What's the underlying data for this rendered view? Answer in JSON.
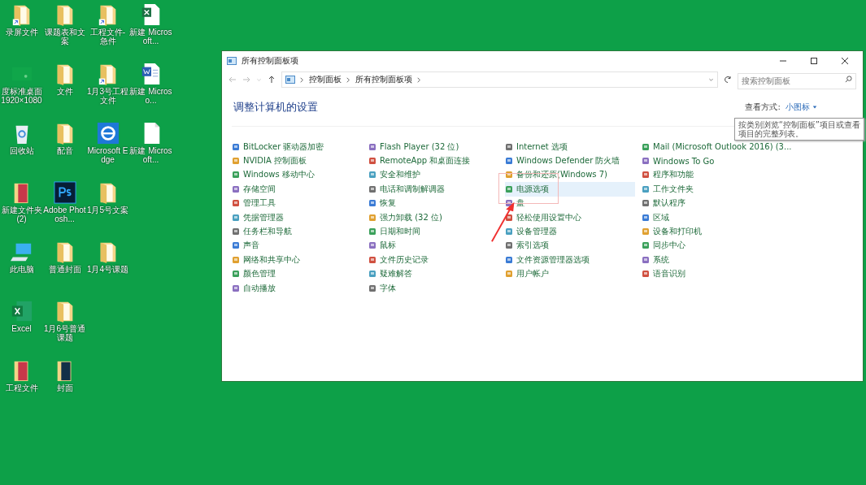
{
  "desktop": [
    {
      "items": [
        {
          "kind": "folder-shortcut",
          "label": "录屏文件"
        },
        {
          "kind": "folder",
          "label": "课题表和文案"
        },
        {
          "kind": "folder-shortcut",
          "label": "工程文件-急件"
        },
        {
          "kind": "excel",
          "label": "新建 Microsoft..."
        }
      ]
    },
    {
      "items": [
        {
          "kind": "wallpaper",
          "label": "度标准桌面 1920×1080"
        },
        {
          "kind": "folder",
          "label": "文件"
        },
        {
          "kind": "folder-shortcut",
          "label": "1月3号工程文件"
        },
        {
          "kind": "word",
          "label": "新建 Microso..."
        }
      ]
    },
    {
      "items": [
        {
          "kind": "recycle",
          "label": "回收站"
        },
        {
          "kind": "folder",
          "label": "配音"
        },
        {
          "kind": "edge",
          "label": "Microsoft Edge"
        },
        {
          "kind": "file",
          "label": "新建 Microsoft..."
        }
      ]
    },
    {
      "items": [
        {
          "kind": "book",
          "label": "新建文件夹 (2)"
        },
        {
          "kind": "ps",
          "label": "Adobe Photosh..."
        },
        {
          "kind": "folder",
          "label": "1月5号文案"
        }
      ]
    },
    {
      "items": [
        {
          "kind": "pc",
          "label": "此电脑"
        },
        {
          "kind": "folder",
          "label": "普通封面"
        },
        {
          "kind": "folder",
          "label": "1月4号课题"
        }
      ]
    },
    {
      "items": [
        {
          "kind": "excel-app",
          "label": "Excel"
        },
        {
          "kind": "folder",
          "label": "1月6号普通课题"
        }
      ]
    },
    {
      "items": [
        {
          "kind": "book",
          "label": "工程文件"
        },
        {
          "kind": "book-dark",
          "label": "封面"
        }
      ]
    }
  ],
  "window": {
    "title": "所有控制面板项",
    "breadcrumb": [
      "控制面板",
      "所有控制面板项"
    ],
    "search": {
      "placeholder": "搜索控制面板"
    },
    "heading": "调整计算机的设置",
    "view_by": {
      "label": "查看方式:",
      "value": "小图标"
    },
    "tooltip": [
      "按类别浏览“控制面板”项目或查看",
      "项目的完整列表。"
    ],
    "columns": [
      [
        {
          "label": "BitLocker 驱动器加密",
          "hovered": false
        },
        {
          "label": "NVIDIA 控制面板",
          "hovered": false
        },
        {
          "label": "Windows 移动中心",
          "hovered": false
        },
        {
          "label": "存储空间",
          "hovered": false
        },
        {
          "label": "管理工具",
          "hovered": false
        },
        {
          "label": "凭据管理器",
          "hovered": false
        },
        {
          "label": "任务栏和导航",
          "hovered": false
        },
        {
          "label": "声音",
          "hovered": false
        },
        {
          "label": "网络和共享中心",
          "hovered": false
        },
        {
          "label": "颜色管理",
          "hovered": false
        },
        {
          "label": "自动播放",
          "hovered": false
        }
      ],
      [
        {
          "label": "Flash Player (32 位)",
          "hovered": false
        },
        {
          "label": "RemoteApp 和桌面连接",
          "hovered": false
        },
        {
          "label": "安全和维护",
          "hovered": false
        },
        {
          "label": "电话和调制解调器",
          "hovered": false
        },
        {
          "label": "恢复",
          "hovered": false
        },
        {
          "label": "强力卸载 (32 位)",
          "hovered": false
        },
        {
          "label": "日期和时间",
          "hovered": false
        },
        {
          "label": "鼠标",
          "hovered": false
        },
        {
          "label": "文件历史记录",
          "hovered": false
        },
        {
          "label": "疑难解答",
          "hovered": false
        },
        {
          "label": "字体",
          "hovered": false
        }
      ],
      [
        {
          "label": "Internet 选项",
          "hovered": false
        },
        {
          "label": "Windows Defender 防火墙",
          "hovered": false
        },
        {
          "label": "备份和还原(Windows 7)",
          "hovered": false
        },
        {
          "label": "电源选项",
          "hovered": true
        },
        {
          "label": "盘",
          "hovered": false
        },
        {
          "label": "轻松使用设置中心",
          "hovered": false
        },
        {
          "label": "设备管理器",
          "hovered": false
        },
        {
          "label": "索引选项",
          "hovered": false
        },
        {
          "label": "文件资源管理器选项",
          "hovered": false
        },
        {
          "label": "用户帐户",
          "hovered": false
        }
      ],
      [
        {
          "label": "Mail (Microsoft Outlook 2016) (3...",
          "hovered": false
        },
        {
          "label": "Windows To Go",
          "hovered": false
        },
        {
          "label": "程序和功能",
          "hovered": false
        },
        {
          "label": "工作文件夹",
          "hovered": false
        },
        {
          "label": "默认程序",
          "hovered": false
        },
        {
          "label": "区域",
          "hovered": false
        },
        {
          "label": "设备和打印机",
          "hovered": false
        },
        {
          "label": "同步中心",
          "hovered": false
        },
        {
          "label": "系统",
          "hovered": false
        },
        {
          "label": "语音识别",
          "hovered": false
        }
      ]
    ]
  }
}
